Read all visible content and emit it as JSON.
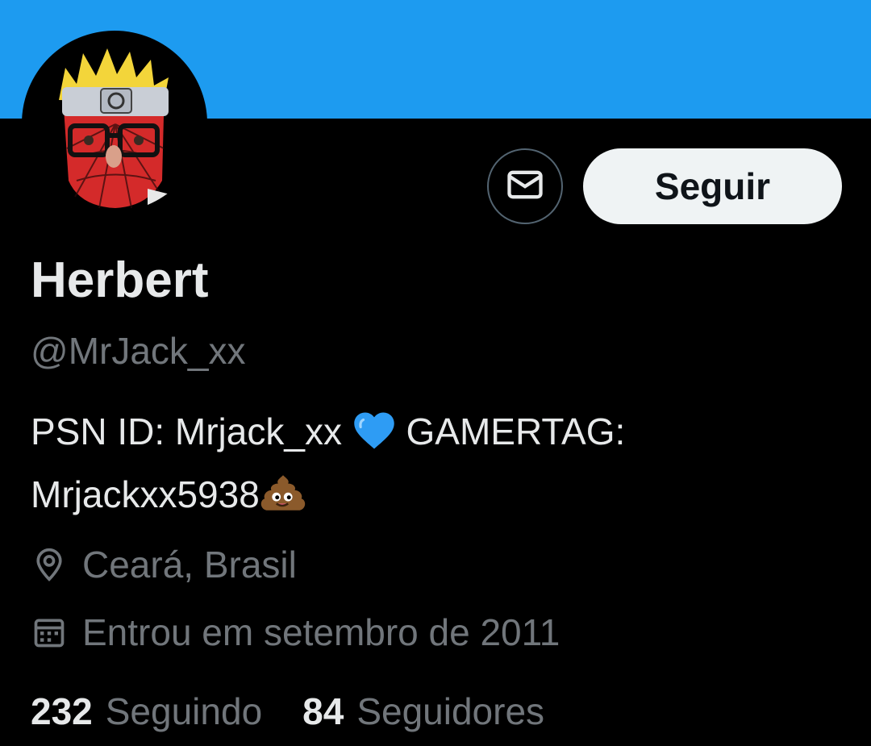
{
  "profile": {
    "display_name": "Herbert",
    "handle": "@MrJack_xx",
    "bio": {
      "part1": "PSN ID: Mrjack_xx ",
      "part2": " GAMERTAG:",
      "part3": "Mrjackxx5938",
      "emoji1": "blue-heart",
      "emoji2": "pile-of-poo"
    },
    "location": "Ceará, Brasil",
    "joined": "Entrou em setembro de 2011",
    "following_count": "232",
    "following_label": "Seguindo",
    "followers_count": "84",
    "followers_label": "Seguidores"
  },
  "actions": {
    "follow_label": "Seguir",
    "message_icon": "envelope-icon"
  },
  "colors": {
    "banner": "#1d9bf0",
    "background": "#000000",
    "primary_text": "#e7e9ea",
    "secondary_text": "#71767b",
    "follow_button_bg": "#eff3f4"
  }
}
